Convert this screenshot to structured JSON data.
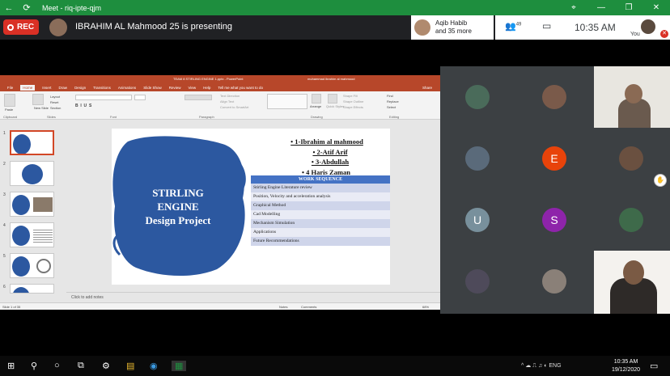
{
  "browser": {
    "title": "Meet - riq-ipte-qjm",
    "back_icon": "←",
    "refresh_icon": "⟳",
    "controls": [
      "⌖",
      "—",
      "❐",
      "✕"
    ]
  },
  "meet": {
    "rec_label": "REC",
    "presenting_text": "IBRAHIM AL Mahmood 25 is presenting",
    "join_name": "Aqib Habib",
    "join_more": "and 35 more",
    "people_count": "49",
    "time": "10:35 AM",
    "you_label": "You"
  },
  "ppt": {
    "window_title": "TEAM 8 STIRLING ENGINE 1.pptx - PowerPoint",
    "user": "muhammad ibrahim al mahmood",
    "tabs": [
      "File",
      "Home",
      "Insert",
      "Draw",
      "Design",
      "Transitions",
      "Animations",
      "Slide Show",
      "Review",
      "View",
      "Help",
      "Tell me what you want to do"
    ],
    "share_label": "Share",
    "ribbon_groups": [
      "Clipboard",
      "Slides",
      "Font",
      "Paragraph",
      "Drawing",
      "Editing"
    ],
    "ribbon_items": {
      "paste": "Paste",
      "new_slide": "New Slide",
      "layout": "Layout",
      "reset": "Reset",
      "section": "Section",
      "text_direction": "Text Direction",
      "align_text": "Align Text",
      "smartart": "Convert to SmartArt",
      "arrange": "Arrange",
      "quick_styles": "Quick Styles",
      "shape_fill": "Shape Fill",
      "shape_outline": "Shape Outline",
      "shape_effects": "Shape Effects",
      "find": "Find",
      "replace": "Replace",
      "select": "Select"
    },
    "thumb_numbers": [
      "1",
      "2",
      "3",
      "4",
      "5",
      "6"
    ],
    "slide": {
      "title_lines": [
        "STIRLING",
        "ENGINE",
        "Design Project"
      ],
      "names": [
        "• 1-Ibrahim al mahmood",
        "• 2-Atif Arif",
        "• 3-Abdullah",
        "• 4 Haris Zaman"
      ],
      "table_header": "WORK SEQUENCE",
      "table_rows": [
        "Stirling Engine Literature review",
        "Position, Velocity and acceleration analysis",
        "Graphical Method",
        "Cad Modelling",
        "Mechanism Simulation",
        "Applications",
        "Future Recommendations"
      ]
    },
    "notes_placeholder": "Click to add notes",
    "status": {
      "slide_of": "Slide 1 of 35",
      "notes": "Notes",
      "comments": "Comments",
      "zoom": "68%"
    }
  },
  "participants": [
    {
      "kind": "photo",
      "color": "#4a6b5a"
    },
    {
      "kind": "photo",
      "color": "#7a5a4a"
    },
    {
      "kind": "video"
    },
    {
      "kind": "photo",
      "color": "#5a6a7a"
    },
    {
      "kind": "letter",
      "letter": "E",
      "color": "#e8430a"
    },
    {
      "kind": "photo",
      "color": "#6a5040"
    },
    {
      "kind": "letter",
      "letter": "U",
      "color": "#78909c"
    },
    {
      "kind": "letter",
      "letter": "S",
      "color": "#8e24aa"
    },
    {
      "kind": "photo",
      "color": "#3e6a4a"
    },
    {
      "kind": "photo",
      "color": "#4e4a5a"
    },
    {
      "kind": "photo",
      "color": "#8a8078"
    },
    {
      "kind": "video"
    }
  ],
  "taskbar": {
    "icons": [
      "⊞",
      "⚲",
      "○",
      "⧉",
      "⚙",
      "▤",
      "◉",
      "▦"
    ],
    "tray": "^ ☁ ⎍ ♫ ◐ ENG",
    "time": "10:35 AM",
    "date": "19/12/2020"
  },
  "colors": {
    "titlebar": "#1e8e3e",
    "rec": "#d93025",
    "ppt_accent": "#b7472a",
    "slide_blue": "#2c58a0",
    "table_header": "#4472c4"
  }
}
